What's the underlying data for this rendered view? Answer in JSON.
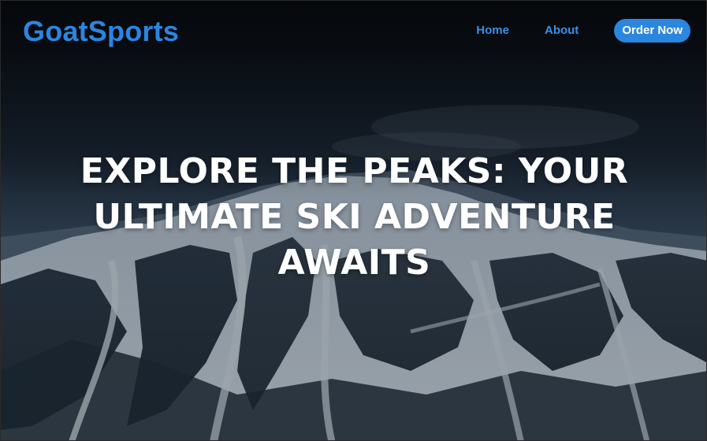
{
  "header": {
    "brand": "GoatSports",
    "nav": {
      "home": "Home",
      "about": "About",
      "order_now": "Order Now"
    }
  },
  "hero": {
    "headline_lines": [
      "EXPLORE THE PEAKS: YOUR",
      "ULTIMATE SKI ADVENTURE",
      "AWAITS"
    ]
  },
  "colors": {
    "brand": "#2b86e0",
    "nav_link": "#3a8fe6",
    "button_text": "#ffffff",
    "headline": "#ffffff"
  }
}
